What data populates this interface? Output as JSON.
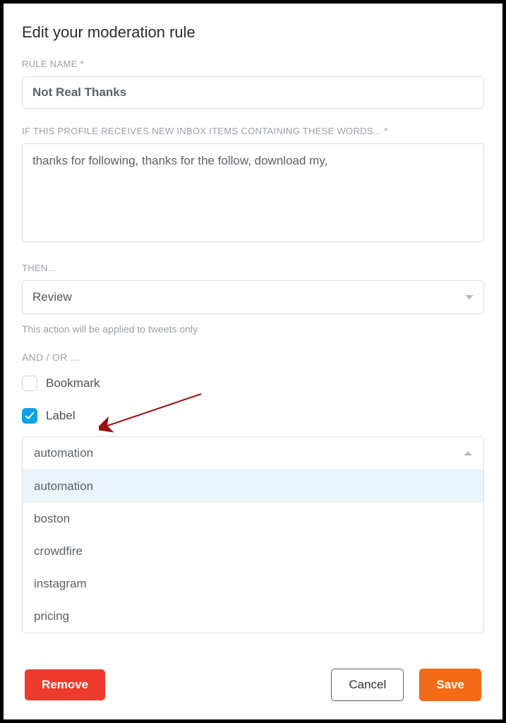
{
  "title": "Edit your moderation rule",
  "ruleName": {
    "label": "RULE NAME *",
    "value": "Not Real Thanks"
  },
  "words": {
    "label": "IF THIS PROFILE RECEIVES NEW INBOX ITEMS CONTAINING THESE WORDS... *",
    "value": "thanks for following, thanks for the follow, download my,"
  },
  "then": {
    "label": "THEN...",
    "value": "Review",
    "helper": "This action will be applied to tweets only"
  },
  "andOr": {
    "label": "AND / OR ...",
    "bookmark": {
      "label": "Bookmark",
      "checked": false
    },
    "labelOpt": {
      "label": "Label",
      "checked": true
    }
  },
  "labelSelect": {
    "selected": "automation",
    "options": [
      "automation",
      "boston",
      "crowdfire",
      "instagram",
      "pricing"
    ]
  },
  "buttons": {
    "remove": "Remove",
    "cancel": "Cancel",
    "save": "Save"
  }
}
